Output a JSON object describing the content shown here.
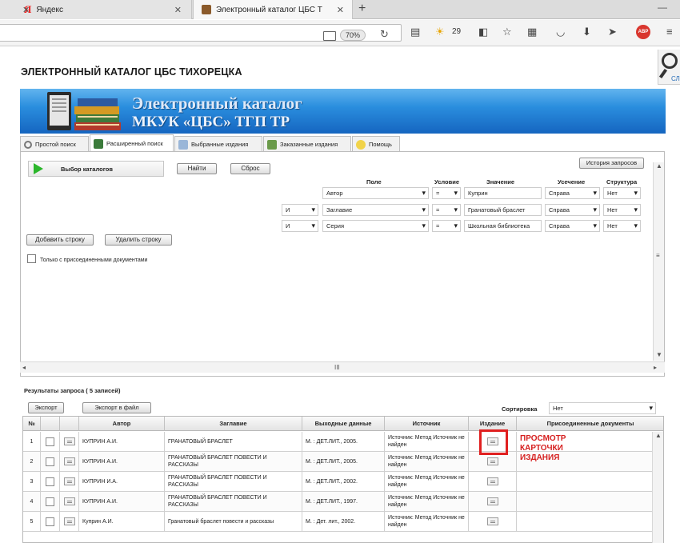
{
  "browser": {
    "tabs": [
      {
        "title": "Яндекс",
        "logo": "Я"
      },
      {
        "title": "Электронный каталог ЦБС Т"
      }
    ],
    "zoom": "70%",
    "weather_temp": "29",
    "abp_label": "ABP"
  },
  "page": {
    "title": "ЭЛЕКТРОННЫЙ КАТАЛОГ ЦБС ТИХОРЕЦКА",
    "banner_line1": "Электронный каталог",
    "banner_line2": "МКУК «ЦБС» ТГП ТР",
    "side_label": "СЛ"
  },
  "tabs": [
    {
      "label": "Простой поиск",
      "active": false
    },
    {
      "label": "Расширенный поиск",
      "active": true
    },
    {
      "label": "Выбранные издания",
      "active": false
    },
    {
      "label": "Заказанные издания",
      "active": false
    },
    {
      "label": "Помощь",
      "active": false
    }
  ],
  "search": {
    "catalog_button": "Выбор каталогов",
    "find_button": "Найти",
    "reset_button": "Сброс",
    "history_button": "История запросов",
    "headers": {
      "field": "Поле",
      "condition": "Условие",
      "value": "Значение",
      "truncation": "Усечение",
      "structure": "Структура"
    },
    "rows": [
      {
        "op": "",
        "field": "Автор",
        "cond": "=",
        "value": "Куприн",
        "trunc": "Справа",
        "struct": "Нет"
      },
      {
        "op": "И",
        "field": "Заглавие",
        "cond": "=",
        "value": "Гранатовый браслет",
        "trunc": "Справа",
        "struct": "Нет"
      },
      {
        "op": "И",
        "field": "Серия",
        "cond": "=",
        "value": "Школьная библиотека",
        "trunc": "Справа",
        "struct": "Нет"
      }
    ],
    "add_row": "Добавить строку",
    "delete_row": "Удалить строку",
    "only_attached": "Только с присоединенными документами",
    "scroll_grip": "III"
  },
  "results": {
    "title": "Результаты запроса ( 5 записей)",
    "export": "Экспорт",
    "export_file": "Экспорт в файл",
    "sort_label": "Сортировка",
    "sort_value": "Нет",
    "columns": [
      "№",
      "",
      "",
      "Автор",
      "Заглавие",
      "Выходные данные",
      "Источник",
      "Издание",
      "Присоединенные документы"
    ],
    "rows": [
      {
        "n": "1",
        "author": "КУПРИН А.И.",
        "title": "ГРАНАТОВЫЙ БРАСЛЕТ",
        "pub": "М. : ДЕТ.ЛИТ., 2005.",
        "source": "Источник: Метод Источник не найден"
      },
      {
        "n": "2",
        "author": "КУПРИН А.И.",
        "title": "ГРАНАТОВЫЙ БРАСЛЕТ ПОВЕСТИ И РАССКАЗЫ",
        "pub": "М. : ДЕТ.ЛИТ., 2005.",
        "source": "Источник: Метод Источник не найден"
      },
      {
        "n": "3",
        "author": "КУПРИН И.А.",
        "title": "ГРАНАТОВЫЙ БРАСЛЕТ ПОВЕСТИ И РАССКАЗЫ",
        "pub": "М. : ДЕТ.ЛИТ., 2002.",
        "source": "Источник: Метод Источник не найден"
      },
      {
        "n": "4",
        "author": "КУПРИН А.И.",
        "title": "ГРАНАТОВЫЙ БРАСЛЕТ ПОВЕСТИ И РАССКАЗЫ",
        "pub": "М. : ДЕТ.ЛИТ., 1997.",
        "source": "Источник: Метод Источник не найден"
      },
      {
        "n": "5",
        "author": "Куприн А.И.",
        "title": "Гранатовый браслет повести и рассказы",
        "pub": "М. : Дет. лит., 2002.",
        "source": "Источник: Метод Источник не найден"
      }
    ]
  },
  "annotation": {
    "line1": "ПРОСМОТР",
    "line2": "КАРТОЧКИ",
    "line3": "ИЗДАНИЯ",
    "color": "#d62020"
  },
  "colors": {
    "banner": "#1e7fd8",
    "accent_green": "#2bb62b",
    "highlight": "#e02020"
  }
}
